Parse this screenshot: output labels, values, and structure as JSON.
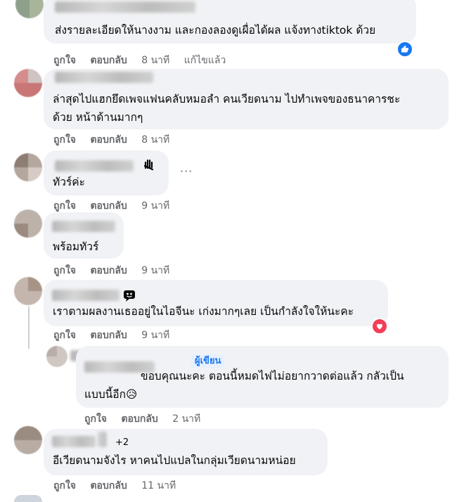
{
  "comments": [
    {
      "text_lines": [
        "ส่งรายละเอียดให้นางงาม และกองลองดูเผื่อได้ผล แจ้งทางtiktok ด้วย"
      ],
      "like": "ถูกใจ",
      "reply": "ตอบกลับ",
      "time": "8 นาที",
      "edited": "แก้ไขแล้ว",
      "reaction": "like"
    },
    {
      "text_lines": [
        "ล่าสุดไปแฮกยึดเพจแฟนคลับหมอลำ คนเวียดนาม ไปทำเพจของธนาคารชะ",
        "ด้วย หน้าด้านมากๆ"
      ],
      "like": "ถูกใจ",
      "reply": "ตอบกลับ",
      "time": "8 นาที"
    },
    {
      "text_lines": [
        "ทัวร์ค่ะ"
      ],
      "like": "ถูกใจ",
      "reply": "ตอบกลับ",
      "time": "9 นาที",
      "badge_icon": "hand-wave-icon"
    },
    {
      "text_lines": [
        "พร้อมทัวร์"
      ],
      "like": "ถูกใจ",
      "reply": "ตอบกลับ",
      "time": "9 นาที"
    },
    {
      "text_lines": [
        "เราตามผลงานเธออยู่ในไอจีนะ เก่งมากๆเลย เป็นกำลังใจให้นะคะ"
      ],
      "like": "ถูกใจ",
      "reply": "ตอบกลับ",
      "time": "9 นาที",
      "reaction": "love",
      "badge_icon": "chat-emoji-icon"
    },
    {
      "author_badge": "ผู้เขียน",
      "text_lines": [
        "ขอบคุณนะคะ ตอนนี้หมดไฟไม่อยากวาดต่อแล้ว กลัวเป็น",
        "แบบนี้อีก😥"
      ],
      "like": "ถูกใจ",
      "reply": "ตอบกลับ",
      "time": "2 นาที"
    },
    {
      "plus": "+2",
      "text_lines": [
        "อีเวียดนามจังไร หาคนไปแปลในกลุ่มเวียดนามหน่อย"
      ],
      "like": "ถูกใจ",
      "reply": "ตอบกลับ",
      "time": "11 นาที"
    }
  ],
  "more_icon": "ellipsis-icon",
  "colors": {
    "bubble": "#f0f2f5",
    "meta": "#65676b",
    "like_blue": "#1877f2",
    "love_red": "#f33e58"
  }
}
